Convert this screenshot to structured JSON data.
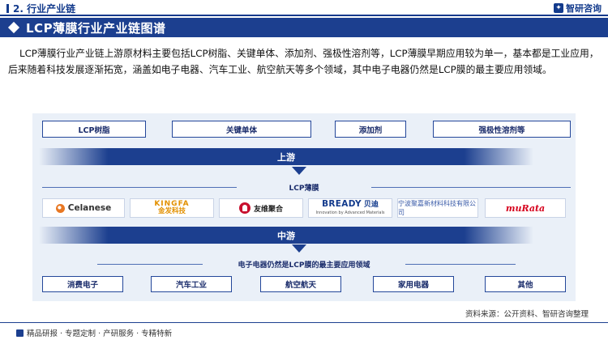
{
  "header": {
    "section": "2. 行业产业链",
    "brand": "智研咨询"
  },
  "title": "LCP薄膜行业产业链图谱",
  "description": "LCP薄膜行业产业链上游原材料主要包括LCP树脂、关键单体、添加剂、强极性溶剂等，LCP薄膜早期应用较为单一，基本都是工业应用，后来随着科技发展逐渐拓宽，涵盖如电子电器、汽车工业、航空航天等多个领域，其中电子电器仍然是LCP膜的最主要应用领域。",
  "upstream": {
    "materials": [
      "LCP树脂",
      "关键单体",
      "添加剂",
      "强极性溶剂等"
    ],
    "label": "上游"
  },
  "midstream": {
    "product": "LCP薄膜",
    "companies": {
      "celanese": "Celanese",
      "kingfa_en": "KINGFA",
      "kingfa_cn": "金发科技",
      "youwei": "友维聚合",
      "bready_en": "BREADY",
      "bready_cn": "贝迪",
      "bready_tag": "Innovation by Advanced Materials",
      "ningbo": "宁波聚嘉新材料科技有限公司",
      "murata": "muRata"
    },
    "label": "中游"
  },
  "downstream": {
    "caption": "电子电器仍然是LCP膜的最主要应用领域",
    "applications": [
      "消费电子",
      "汽车工业",
      "航空航天",
      "家用电器",
      "其他"
    ]
  },
  "footer": {
    "source": "资料来源：公开资料、智研咨询整理",
    "services": "精品研报 · 专题定制 · 产研服务 · 专精特新"
  },
  "colors": {
    "primary": "#1c3f8f",
    "panel": "#eaf0f8"
  }
}
